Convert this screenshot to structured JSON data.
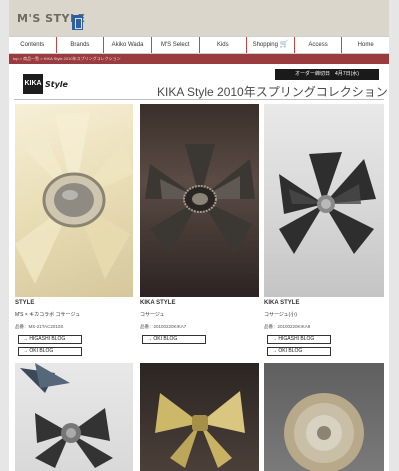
{
  "site": {
    "logo_text": "M'S STYLE"
  },
  "nav": [
    "Contents",
    "Brands",
    "Akiko Wada",
    "M'S Select",
    "Kids",
    "Shopping",
    "Access",
    "Home"
  ],
  "breadcrumb": "top > 商品一覧 > KIKA Style 2010年スプリングコレクション",
  "header": {
    "kika_box": "KIKA",
    "kika_style": "Style",
    "order_badge": "オーダー締切日　4月7日(水)",
    "title": "KIKA Style 2010年スプリングコレクション"
  },
  "products": [
    {
      "brand": "STYLE",
      "name": "M'S × キカコラボ コサージュ",
      "code": "品番：MS-21TAC2010S",
      "buttons": [
        "→ HIGASHI BLOG",
        "→ OKI BLOG"
      ]
    },
    {
      "brand": "KIKA STYLE",
      "name": "コサージュ",
      "code": "品番：20100220KIKA7",
      "buttons": [
        "→ OKI BLOG"
      ]
    },
    {
      "brand": "KIKA STYLE",
      "name": "コサージュ(小)",
      "code": "品番：20100220KIKA9",
      "buttons": [
        "→ HIGASHI BLOG",
        "→ OKI BLOG"
      ]
    }
  ]
}
